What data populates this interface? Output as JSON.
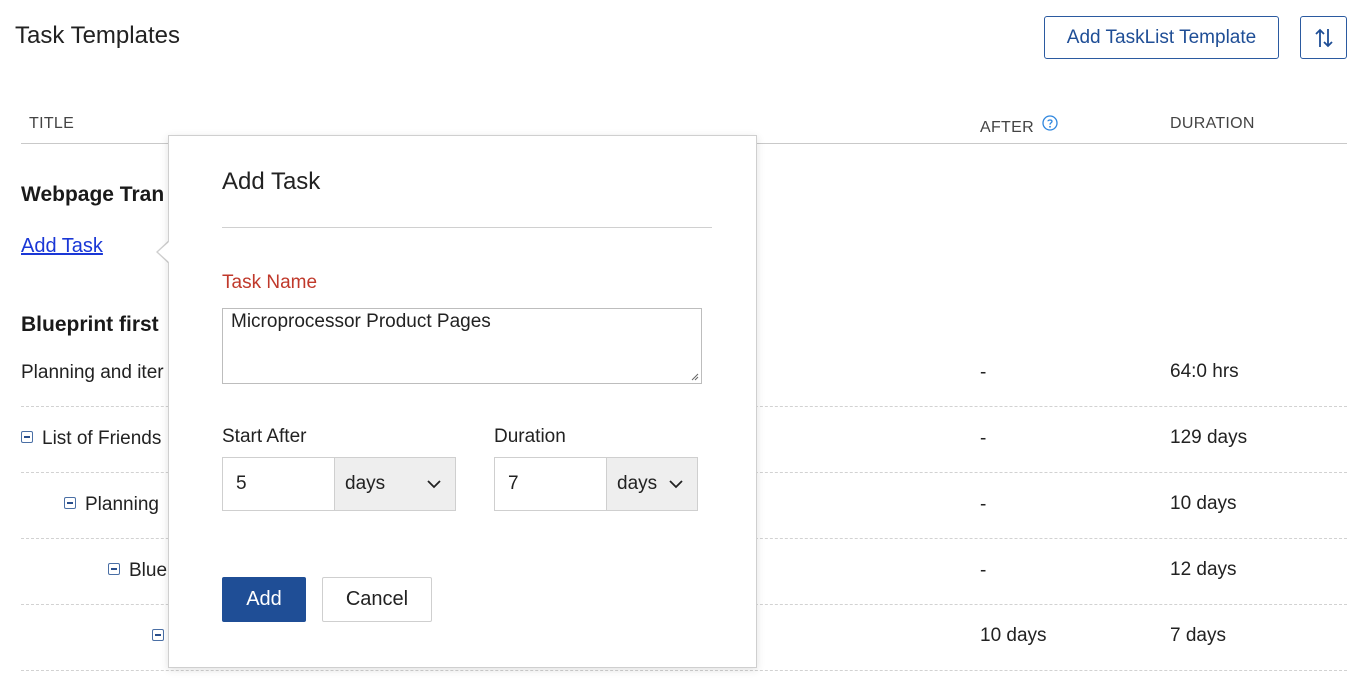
{
  "header": {
    "title": "Task Templates",
    "add_tasklist_label": "Add TaskList Template"
  },
  "columns": {
    "title": "TITLE",
    "after": "AFTER",
    "duration": "DURATION"
  },
  "groups": [
    {
      "title": "Webpage Tran",
      "add_task_label": "Add Task"
    },
    {
      "title": "Blueprint first"
    }
  ],
  "rows": [
    {
      "title": "Planning and iter",
      "after": "-",
      "duration": "64:0 hrs"
    },
    {
      "title": "List of Friends",
      "after": "-",
      "duration": "129 days"
    },
    {
      "title": "Planning",
      "after": "-",
      "duration": "10 days"
    },
    {
      "title": "Blue",
      "after": "-",
      "duration": "12 days"
    },
    {
      "title": "",
      "after": "10 days",
      "duration": "7 days"
    }
  ],
  "dialog": {
    "title": "Add Task",
    "task_name_label": "Task Name",
    "task_name_value": "Microprocessor Product Pages",
    "start_after_label": "Start After",
    "start_after_value": "5",
    "start_after_unit": "days",
    "duration_label": "Duration",
    "duration_value": "7",
    "duration_unit": "days",
    "add_label": "Add",
    "cancel_label": "Cancel"
  },
  "colors": {
    "primary": "#1f4e96",
    "link": "#1a37d6",
    "required": "#c0392b"
  }
}
